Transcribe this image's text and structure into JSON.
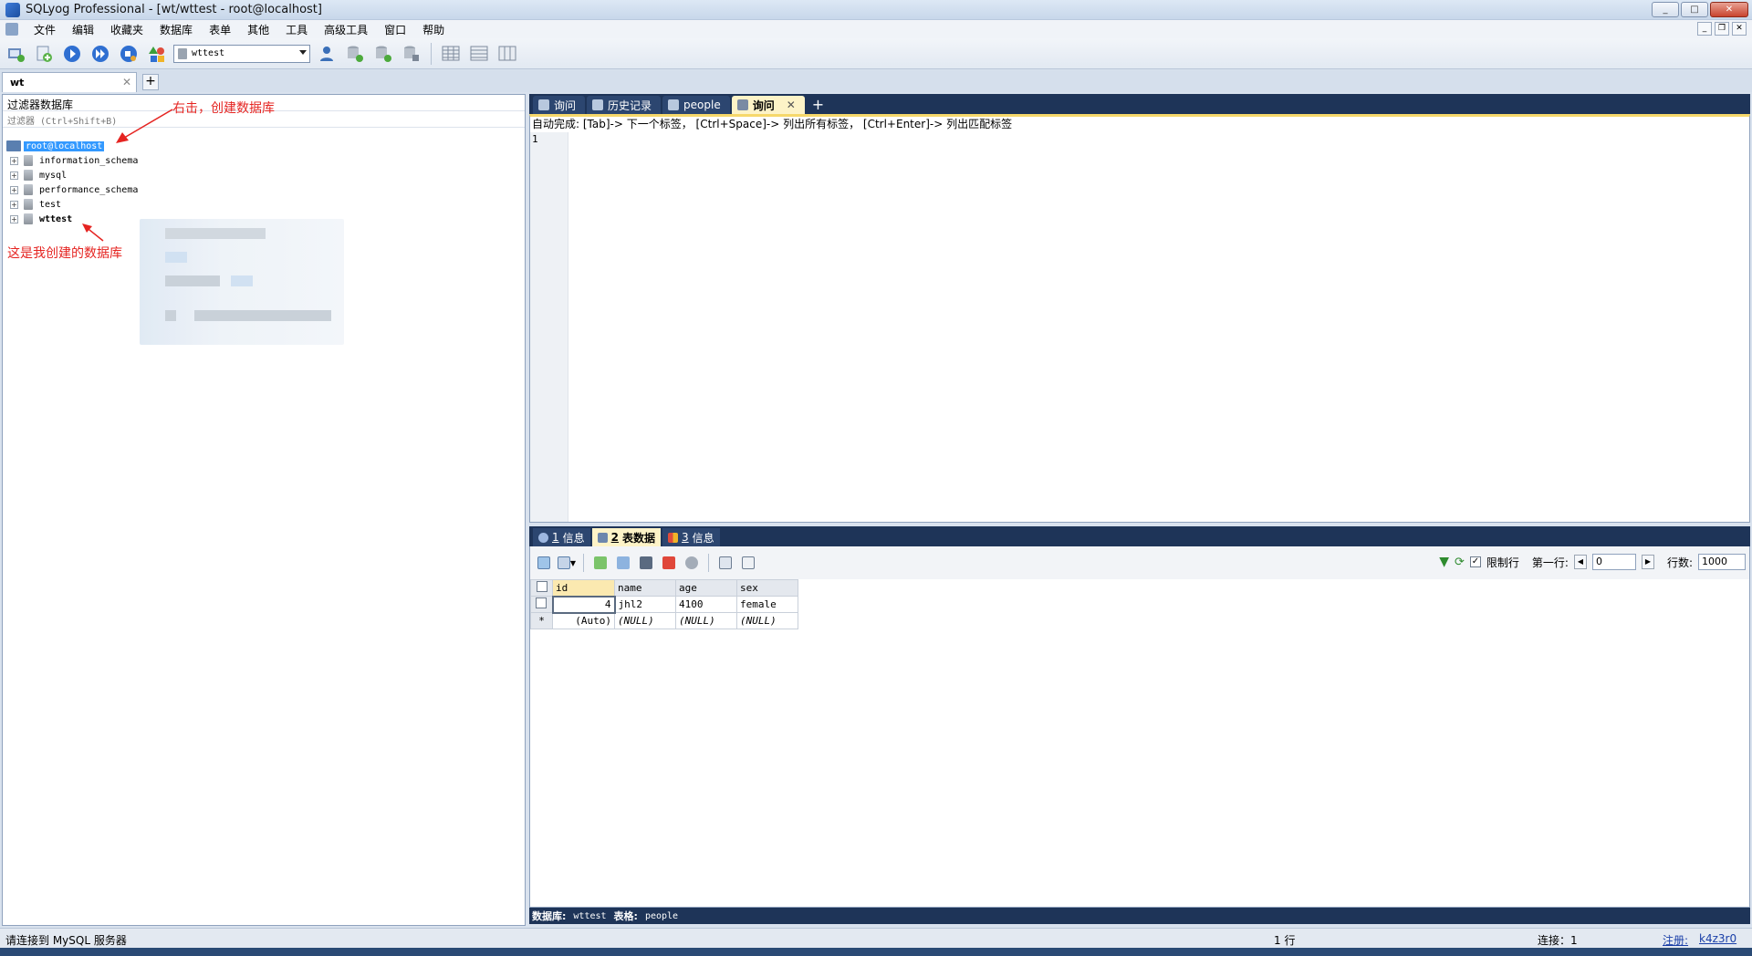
{
  "window": {
    "title": "SQLyog Professional - [wt/wttest - root@localhost]",
    "minimize": "_",
    "maximize": "□",
    "close": "✕"
  },
  "menu": [
    "文件",
    "编辑",
    "收藏夹",
    "数据库",
    "表单",
    "其他",
    "工具",
    "高级工具",
    "窗口",
    "帮助"
  ],
  "toolbar": {
    "db_selector": "wttest"
  },
  "connection_tab": {
    "label": "wt",
    "close": "✕",
    "add": "+"
  },
  "object_browser": {
    "header": "过滤器数据库",
    "filter_placeholder": "过滤器 (Ctrl+Shift+B)",
    "root": "root@localhost",
    "databases": [
      "information_schema",
      "mysql",
      "performance_schema",
      "test",
      "wttest"
    ],
    "annotation_right_click": "右击，创建数据库",
    "annotation_created": "这是我创建的数据库"
  },
  "query_tabs": [
    {
      "label": "询问",
      "active": false
    },
    {
      "label": "历史记录",
      "active": false
    },
    {
      "label": "people",
      "active": false
    },
    {
      "label": "询问",
      "active": true
    }
  ],
  "editor": {
    "autocomplete_hint": "自动完成: [Tab]-> 下一个标签， [Ctrl+Space]-> 列出所有标签， [Ctrl+Enter]-> 列出匹配标签",
    "line_number": "1"
  },
  "result_tabs": [
    {
      "num": "1",
      "label": " 信息",
      "active": false
    },
    {
      "num": "2",
      "label": " 表数据",
      "active": true
    },
    {
      "num": "3",
      "label": " 信息",
      "active": false
    }
  ],
  "grid_toolbar": {
    "limit_label": "限制行",
    "first_row_label": "第一行:",
    "first_row_value": "0",
    "rows_label": "行数:",
    "rows_value": "1000"
  },
  "grid": {
    "columns": [
      "id",
      "name",
      "age",
      "sex"
    ],
    "rows": [
      [
        "4",
        "jhl2",
        "4100",
        "female"
      ],
      [
        "(Auto)",
        "(NULL)",
        "(NULL)",
        "(NULL)"
      ]
    ],
    "new_row_marker": "*"
  },
  "info_line": {
    "db_label": "数据库:",
    "db_value": "wttest",
    "table_label": "表格:",
    "table_value": "people"
  },
  "statusbar": {
    "message": "请连接到 MySQL 服务器",
    "rows": "1 行",
    "connections": "连接：1",
    "register_label": "注册:",
    "register_value": "k4z3r0"
  }
}
